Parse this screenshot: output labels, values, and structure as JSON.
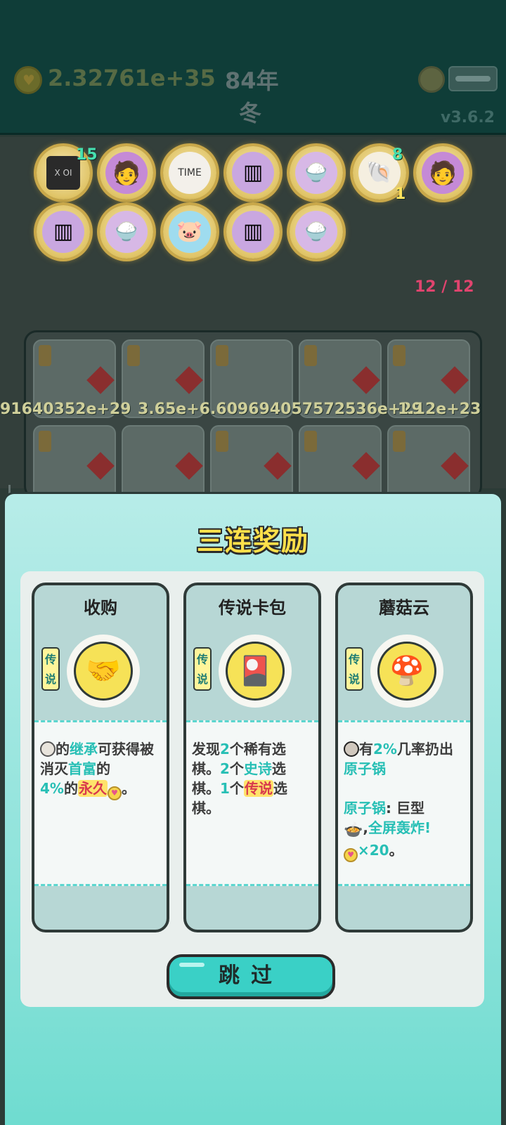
{
  "status": {
    "money": "2.32761e+35",
    "year": "84年",
    "season": "冬",
    "version": "v3.6.2"
  },
  "relics": {
    "items": [
      {
        "icon": "chip-icon",
        "count": "15"
      },
      {
        "icon": "lucky-numbers-icon",
        "count": ""
      },
      {
        "icon": "time-magazine-icon",
        "count": ""
      },
      {
        "icon": "pleated-skirt-icon",
        "count": ""
      },
      {
        "icon": "rice-bowls-up-icon",
        "count": ""
      },
      {
        "icon": "shell-icon",
        "count": "8",
        "subcount": "1"
      },
      {
        "icon": "lucky-numbers-icon",
        "count": ""
      },
      {
        "icon": "pleated-skirt-icon",
        "count": ""
      },
      {
        "icon": "rice-bowls-up-icon",
        "count": ""
      },
      {
        "icon": "piggy-bank-icon",
        "count": ""
      },
      {
        "icon": "pleated-skirt-icon",
        "count": ""
      },
      {
        "icon": "rice-bowls-up-icon",
        "count": ""
      }
    ],
    "page_count": "12 / 12"
  },
  "board": {
    "values": [
      "91640352e+29",
      "3.65e+6.609694057572536e+29",
      "1.12e+23"
    ]
  },
  "modal": {
    "title": "三连奖励",
    "cards": [
      {
        "name": "收购",
        "rarity": "传说",
        "icon": "handshake-icon",
        "desc": {
          "t1": "的",
          "t2": "继承",
          "t3": "可获得被消灭",
          "t4": "首富",
          "t5": "的",
          "t6": "4%",
          "t7": "的",
          "t8": "永久",
          "t9": "。"
        }
      },
      {
        "name": "传说卡包",
        "rarity": "传说",
        "icon": "card-pack-icon",
        "desc": {
          "t1": "发现",
          "t2": "2",
          "t3": "个稀有选棋。",
          "t4": "2",
          "t5": "个",
          "t6": "史诗",
          "t7": "选棋。",
          "t8": "1",
          "t9": "个",
          "t10": "传说",
          "t11": "选棋。"
        }
      },
      {
        "name": "蘑菇云",
        "rarity": "传说",
        "icon": "mushroom-cloud-icon",
        "desc": {
          "t1": "有",
          "t2": "2%",
          "t3": "几率扔出",
          "t4": "原子锅",
          "t5": "原子锅",
          "t6": ": 巨型",
          "t7": ",",
          "t8": "全屏轰炸!",
          "t9": "×20",
          "t10": "。"
        }
      }
    ],
    "skip_label": "跳过"
  },
  "colors": {
    "accent_teal": "#27bfb5",
    "title_yellow": "#ffe04a",
    "legend_red": "#d8394d"
  }
}
